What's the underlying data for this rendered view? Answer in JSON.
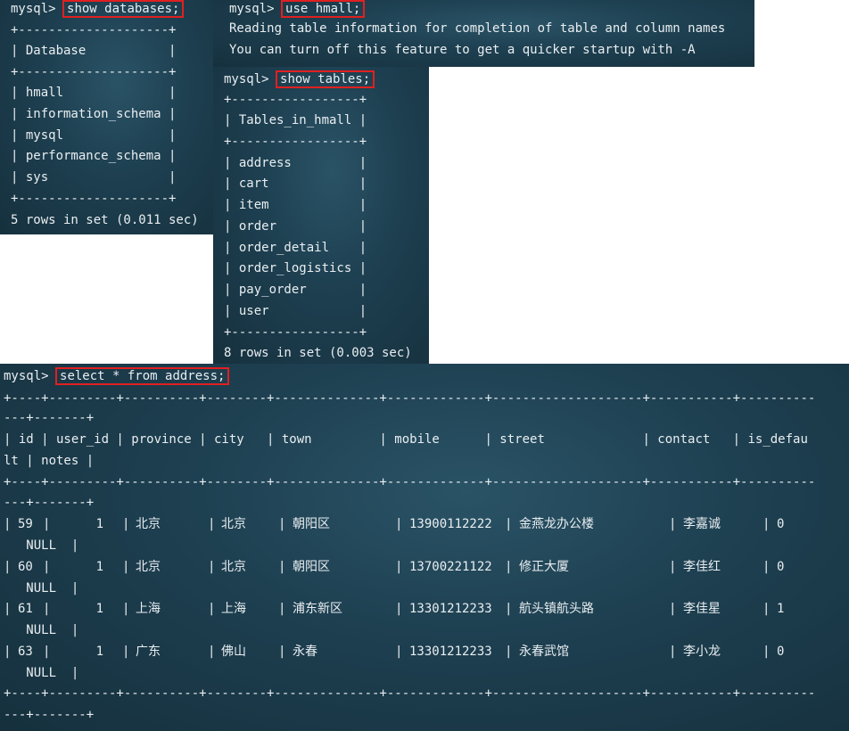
{
  "panel_databases": {
    "prompt": "mysql>",
    "command": "show databases;",
    "border": "+--------------------+",
    "header": "| Database           |",
    "rows": [
      "| hmall              |",
      "| information_schema |",
      "| mysql              |",
      "| performance_schema |",
      "| sys                |"
    ],
    "footer": "5 rows in set (0.011 sec)"
  },
  "panel_use": {
    "prompt": "mysql>",
    "command": "use hmall;",
    "message1": "Reading table information for completion of table and column names",
    "message2": "You can turn off this feature to get a quicker startup with -A"
  },
  "panel_tables": {
    "prompt": "mysql>",
    "command": "show tables;",
    "border": "+-----------------+",
    "header": "| Tables_in_hmall |",
    "rows": [
      "| address         |",
      "| cart            |",
      "| item            |",
      "| order           |",
      "| order_detail    |",
      "| order_logistics |",
      "| pay_order       |",
      "| user            |"
    ],
    "footer": "8 rows in set (0.003 sec)"
  },
  "panel_select": {
    "prompt": "mysql>",
    "command": "select * from address;",
    "border_a": "+----+---------+----------+--------+--------------+-------------+--------------------+-----------+----------",
    "border_b": "---+-------+",
    "header_a": "| id | user_id | province | city   | town         | mobile      | street             | contact   | is_defau",
    "header_b": "lt | notes |",
    "rows": [
      {
        "id": "59",
        "user_id": "1",
        "province": "北京",
        "city": "北京",
        "town": "朝阳区",
        "mobile": "13900112222",
        "street": "金燕龙办公楼",
        "contact": "李嘉诚",
        "is_default": "0",
        "notes": "NULL"
      },
      {
        "id": "60",
        "user_id": "1",
        "province": "北京",
        "city": "北京",
        "town": "朝阳区",
        "mobile": "13700221122",
        "street": "修正大厦",
        "contact": "李佳红",
        "is_default": "0",
        "notes": "NULL"
      },
      {
        "id": "61",
        "user_id": "1",
        "province": "上海",
        "city": "上海",
        "town": "浦东新区",
        "mobile": "13301212233",
        "street": "航头镇航头路",
        "contact": "李佳星",
        "is_default": "1",
        "notes": "NULL"
      },
      {
        "id": "63",
        "user_id": "1",
        "province": "广东",
        "city": "佛山",
        "town": "永春",
        "mobile": "13301212233",
        "street": "永春武馆",
        "contact": "李小龙",
        "is_default": "0",
        "notes": "NULL"
      }
    ]
  },
  "colors": {
    "highlight_box": "#e02020",
    "terminal_bg": "#1d3f50",
    "terminal_text": "#e9eef1"
  }
}
